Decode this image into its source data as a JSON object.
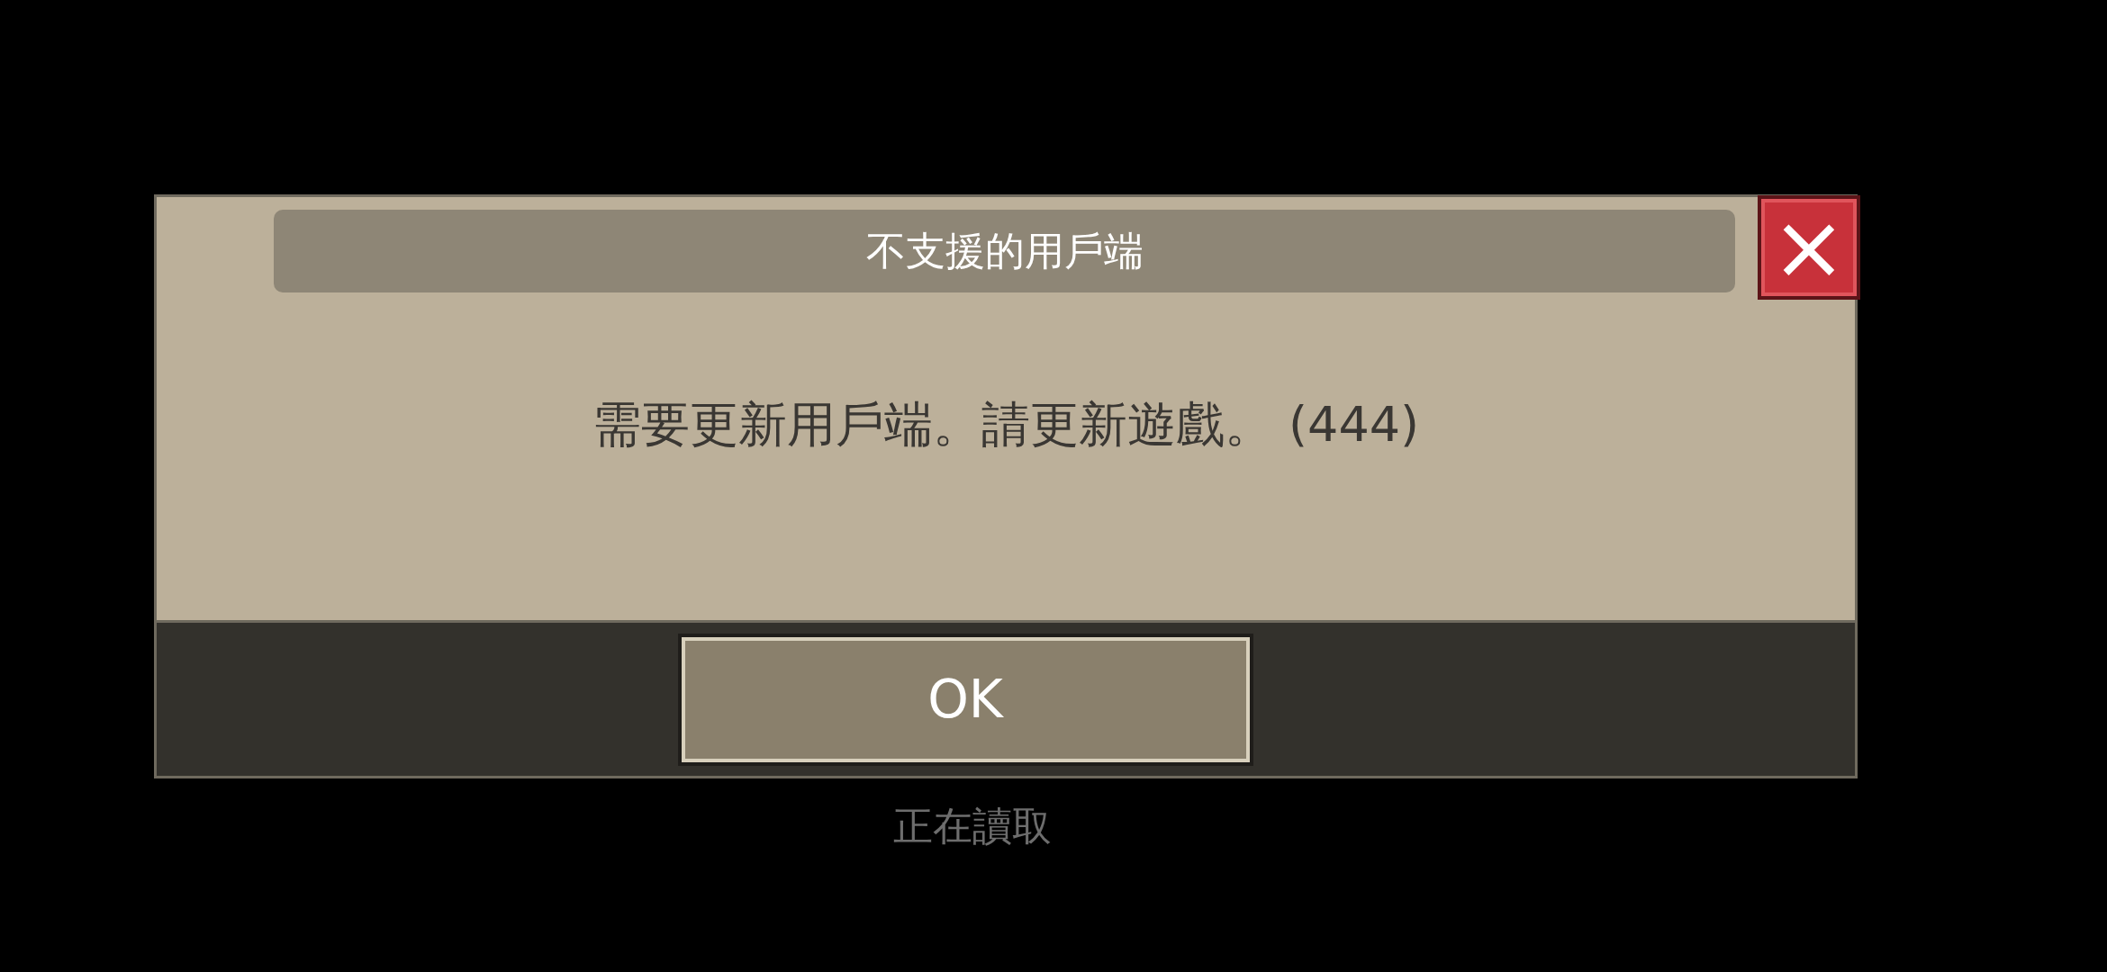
{
  "dialog": {
    "title": "不支援的用戶端",
    "close": "×",
    "message": "需要更新用戶端。請更新遊戲。 (444)",
    "buttons": [
      "OK"
    ]
  },
  "status": "正在讀取"
}
